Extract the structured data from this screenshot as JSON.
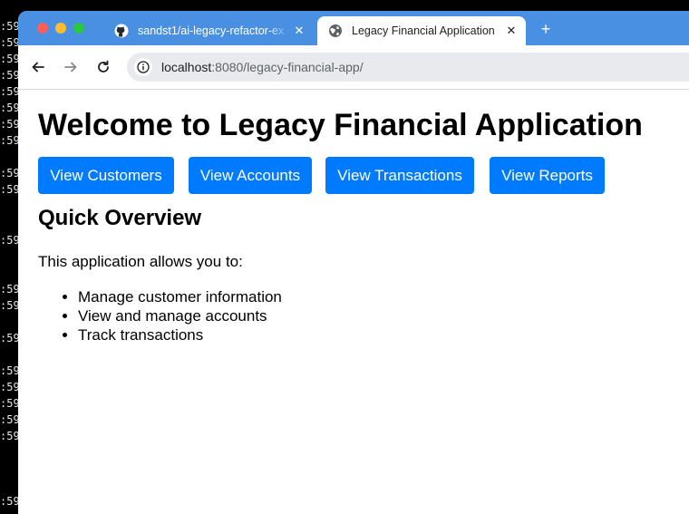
{
  "terminal": {
    "top_line": "cut",
    "lines": [
      ":59",
      ":59",
      ":59",
      ":59",
      ":59",
      ":59",
      ":59",
      ":59",
      ":59",
      ":59",
      ":59",
      ":59",
      ":59",
      ":59",
      ":59",
      ":59",
      ":59",
      ":59",
      ":59",
      ":59"
    ]
  },
  "browser": {
    "tabs": [
      {
        "title": "sandst1/ai-legacy-refactor-ex",
        "icon": "github-icon",
        "active": false
      },
      {
        "title": "Legacy Financial Application",
        "icon": "globe-icon",
        "active": true
      }
    ],
    "close_glyph": "✕",
    "new_tab_glyph": "+",
    "url_host": "localhost",
    "url_rest": ":8080/legacy-financial-app/",
    "colors": {
      "tabbar": "#4a90e2",
      "omnibox": "#e8eaed"
    }
  },
  "page": {
    "title": "Welcome to Legacy Financial Application",
    "buttons": [
      "View Customers",
      "View Accounts",
      "View Transactions",
      "View Reports"
    ],
    "button_color": "#007bff",
    "section_heading": "Quick Overview",
    "intro": "This application allows you to:",
    "features": [
      "Manage customer information",
      "View and manage accounts",
      "Track transactions"
    ]
  }
}
